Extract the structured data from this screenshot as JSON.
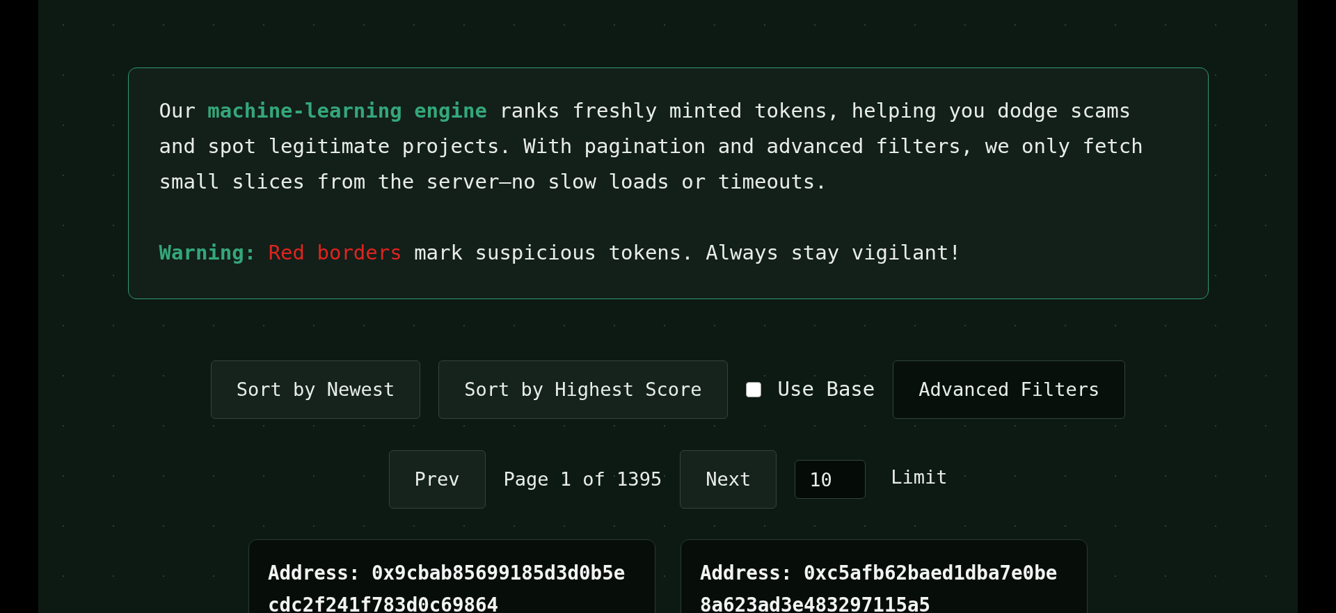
{
  "intro": {
    "paragraph": [
      {
        "kind": "plain",
        "text": "Our "
      },
      {
        "kind": "highlight",
        "text": "machine-learning engine"
      },
      {
        "kind": "plain",
        "text": " ranks freshly minted tokens, helping you dodge scams and spot legitimate projects. With pagination and advanced filters, we only fetch small slices from the server—no slow loads or timeouts."
      }
    ],
    "warning": [
      {
        "kind": "highlight",
        "text": "Warning: "
      },
      {
        "kind": "danger",
        "text": "Red borders"
      },
      {
        "kind": "plain",
        "text": " mark suspicious tokens. Always stay vigilant!"
      }
    ]
  },
  "controls": {
    "sort_buttons": [
      {
        "label": "Sort by Newest"
      },
      {
        "label": "Sort by Highest Score"
      }
    ],
    "use_base": {
      "label": "Use Base",
      "checked": false
    },
    "advanced_filters": {
      "label": "Advanced Filters"
    }
  },
  "pagination": {
    "prev": "Prev",
    "page_info": "Page 1 of 1395",
    "next": "Next",
    "limit_value": "10",
    "limit_label": "Limit"
  },
  "tokens": [
    {
      "address": "Address: 0x9cbab85699185d3d0b5ecdc2f241f783d0c69864"
    },
    {
      "address": "Address: 0xc5afb62baed1dba7e0be8a623ad3e483297115a5"
    }
  ]
}
